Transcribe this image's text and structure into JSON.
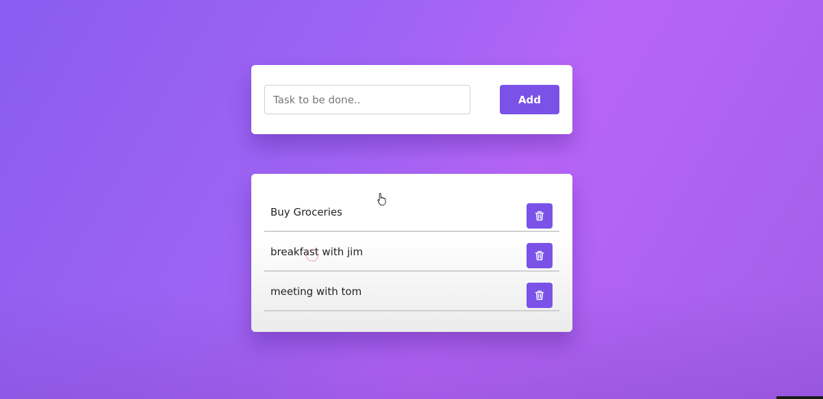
{
  "input_panel": {
    "placeholder": "Task to be done..",
    "value": "",
    "add_label": "Add"
  },
  "tasks": [
    {
      "text": "Buy Groceries",
      "delete_icon": "trash-icon"
    },
    {
      "text": "breakfast with jim",
      "delete_icon": "trash-icon"
    },
    {
      "text": "meeting with tom",
      "delete_icon": "trash-icon"
    }
  ],
  "colors": {
    "accent": "#7a52e8",
    "background_start": "#8a5cf0",
    "background_end": "#b765f6",
    "card": "#ffffff",
    "divider": "#cfcfcf"
  }
}
